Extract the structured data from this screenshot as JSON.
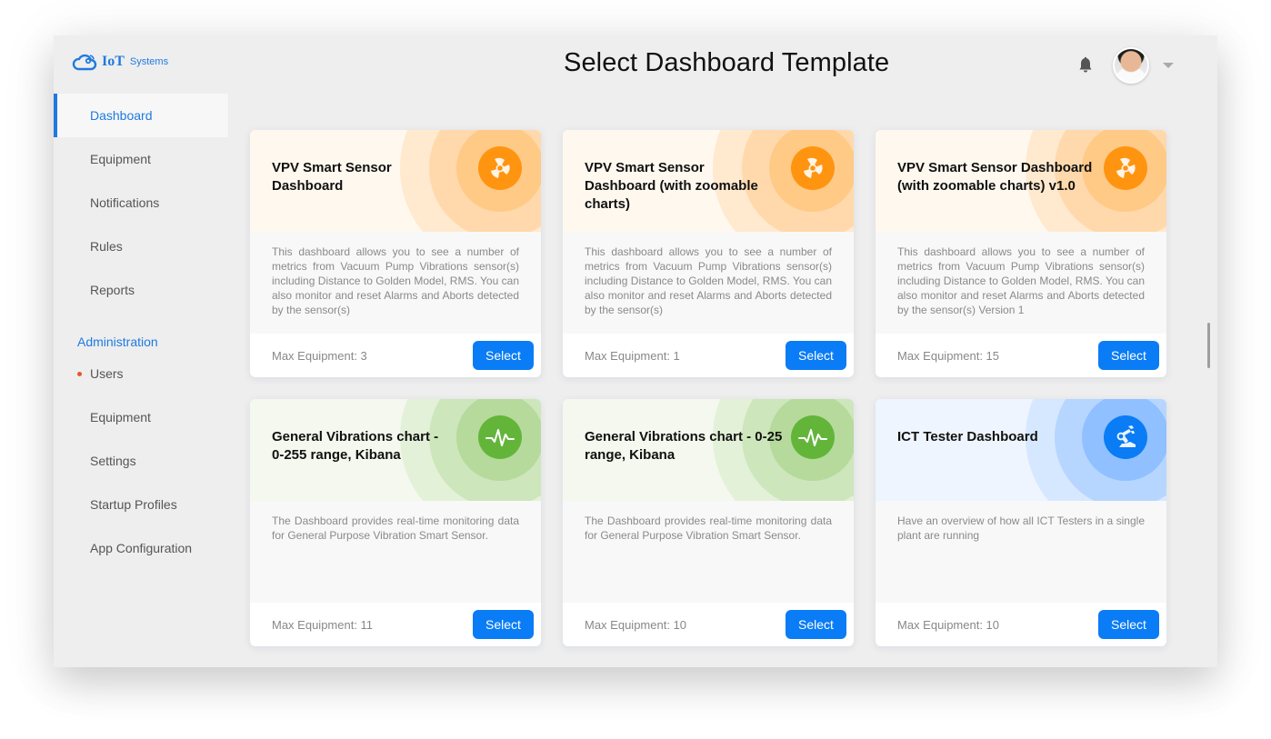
{
  "app": {
    "logo_text": "IoT",
    "logo_sub": "Systems"
  },
  "header": {
    "title": "Select Dashboard Template",
    "icons": [
      "bell-icon",
      "avatar",
      "chevron-down-icon"
    ]
  },
  "sidebar": {
    "items": [
      {
        "label": "Dashboard",
        "active": true
      },
      {
        "label": "Equipment"
      },
      {
        "label": "Notifications"
      },
      {
        "label": "Rules"
      },
      {
        "label": "Reports"
      }
    ],
    "admin_section": "Administration",
    "admin_items": [
      {
        "label": "Users",
        "badge_dot": true
      },
      {
        "label": "Equipment"
      },
      {
        "label": "Settings"
      },
      {
        "label": "Startup Profiles"
      },
      {
        "label": "App Configuration"
      }
    ]
  },
  "colors": {
    "accent": "#1f7ae0",
    "button": "#0a7cf5",
    "orange": "#ff9410",
    "green": "#63b53a",
    "blue": "#0a7cf5",
    "notify_dot": "#e8542e"
  },
  "cards": [
    {
      "title": "VPV Smart Sensor Dashboard",
      "icon": "fan-icon",
      "theme": "orange",
      "description": "This dashboard allows you to see a number of metrics from Vacuum Pump Vibrations sensor(s) including Distance to Golden Model, RMS. You can also monitor and reset Alarms and Aborts detected by the sensor(s)",
      "max_equipment": "Max Equipment: 3",
      "button": "Select"
    },
    {
      "title": "VPV Smart Sensor Dashboard (with zoomable charts)",
      "icon": "fan-icon",
      "theme": "orange",
      "description": "This dashboard allows you to see a number of metrics from Vacuum Pump Vibrations sensor(s) including Distance to Golden Model, RMS. You can also monitor and reset Alarms and Aborts detected by the sensor(s)",
      "max_equipment": "Max Equipment: 1",
      "button": "Select"
    },
    {
      "title": "VPV Smart Sensor Dashboard (with zoomable charts) v1.0",
      "icon": "fan-icon",
      "theme": "orange",
      "description": "This dashboard allows you to see a number of metrics from Vacuum Pump Vibrations sensor(s) including Distance to Golden Model, RMS. You can also monitor and reset Alarms and Aborts detected by the sensor(s) Version 1",
      "max_equipment": "Max Equipment: 15",
      "button": "Select"
    },
    {
      "title": "General Vibrations chart - 0-255 range, Kibana",
      "icon": "pulse-icon",
      "theme": "green",
      "description": "The Dashboard provides real-time monitoring data for General Purpose Vibration Smart Sensor.",
      "max_equipment": "Max Equipment: 11",
      "button": "Select"
    },
    {
      "title": "General Vibrations chart - 0-25 range, Kibana",
      "icon": "pulse-icon",
      "theme": "green",
      "description": "The Dashboard provides real-time monitoring data for General Purpose Vibration Smart Sensor.",
      "max_equipment": "Max Equipment: 10",
      "button": "Select"
    },
    {
      "title": "ICT Tester Dashboard",
      "icon": "robot-arm-icon",
      "theme": "blue",
      "description": "Have an overview of how all ICT Testers in a single plant are running",
      "max_equipment": "Max Equipment: 10",
      "button": "Select"
    }
  ]
}
